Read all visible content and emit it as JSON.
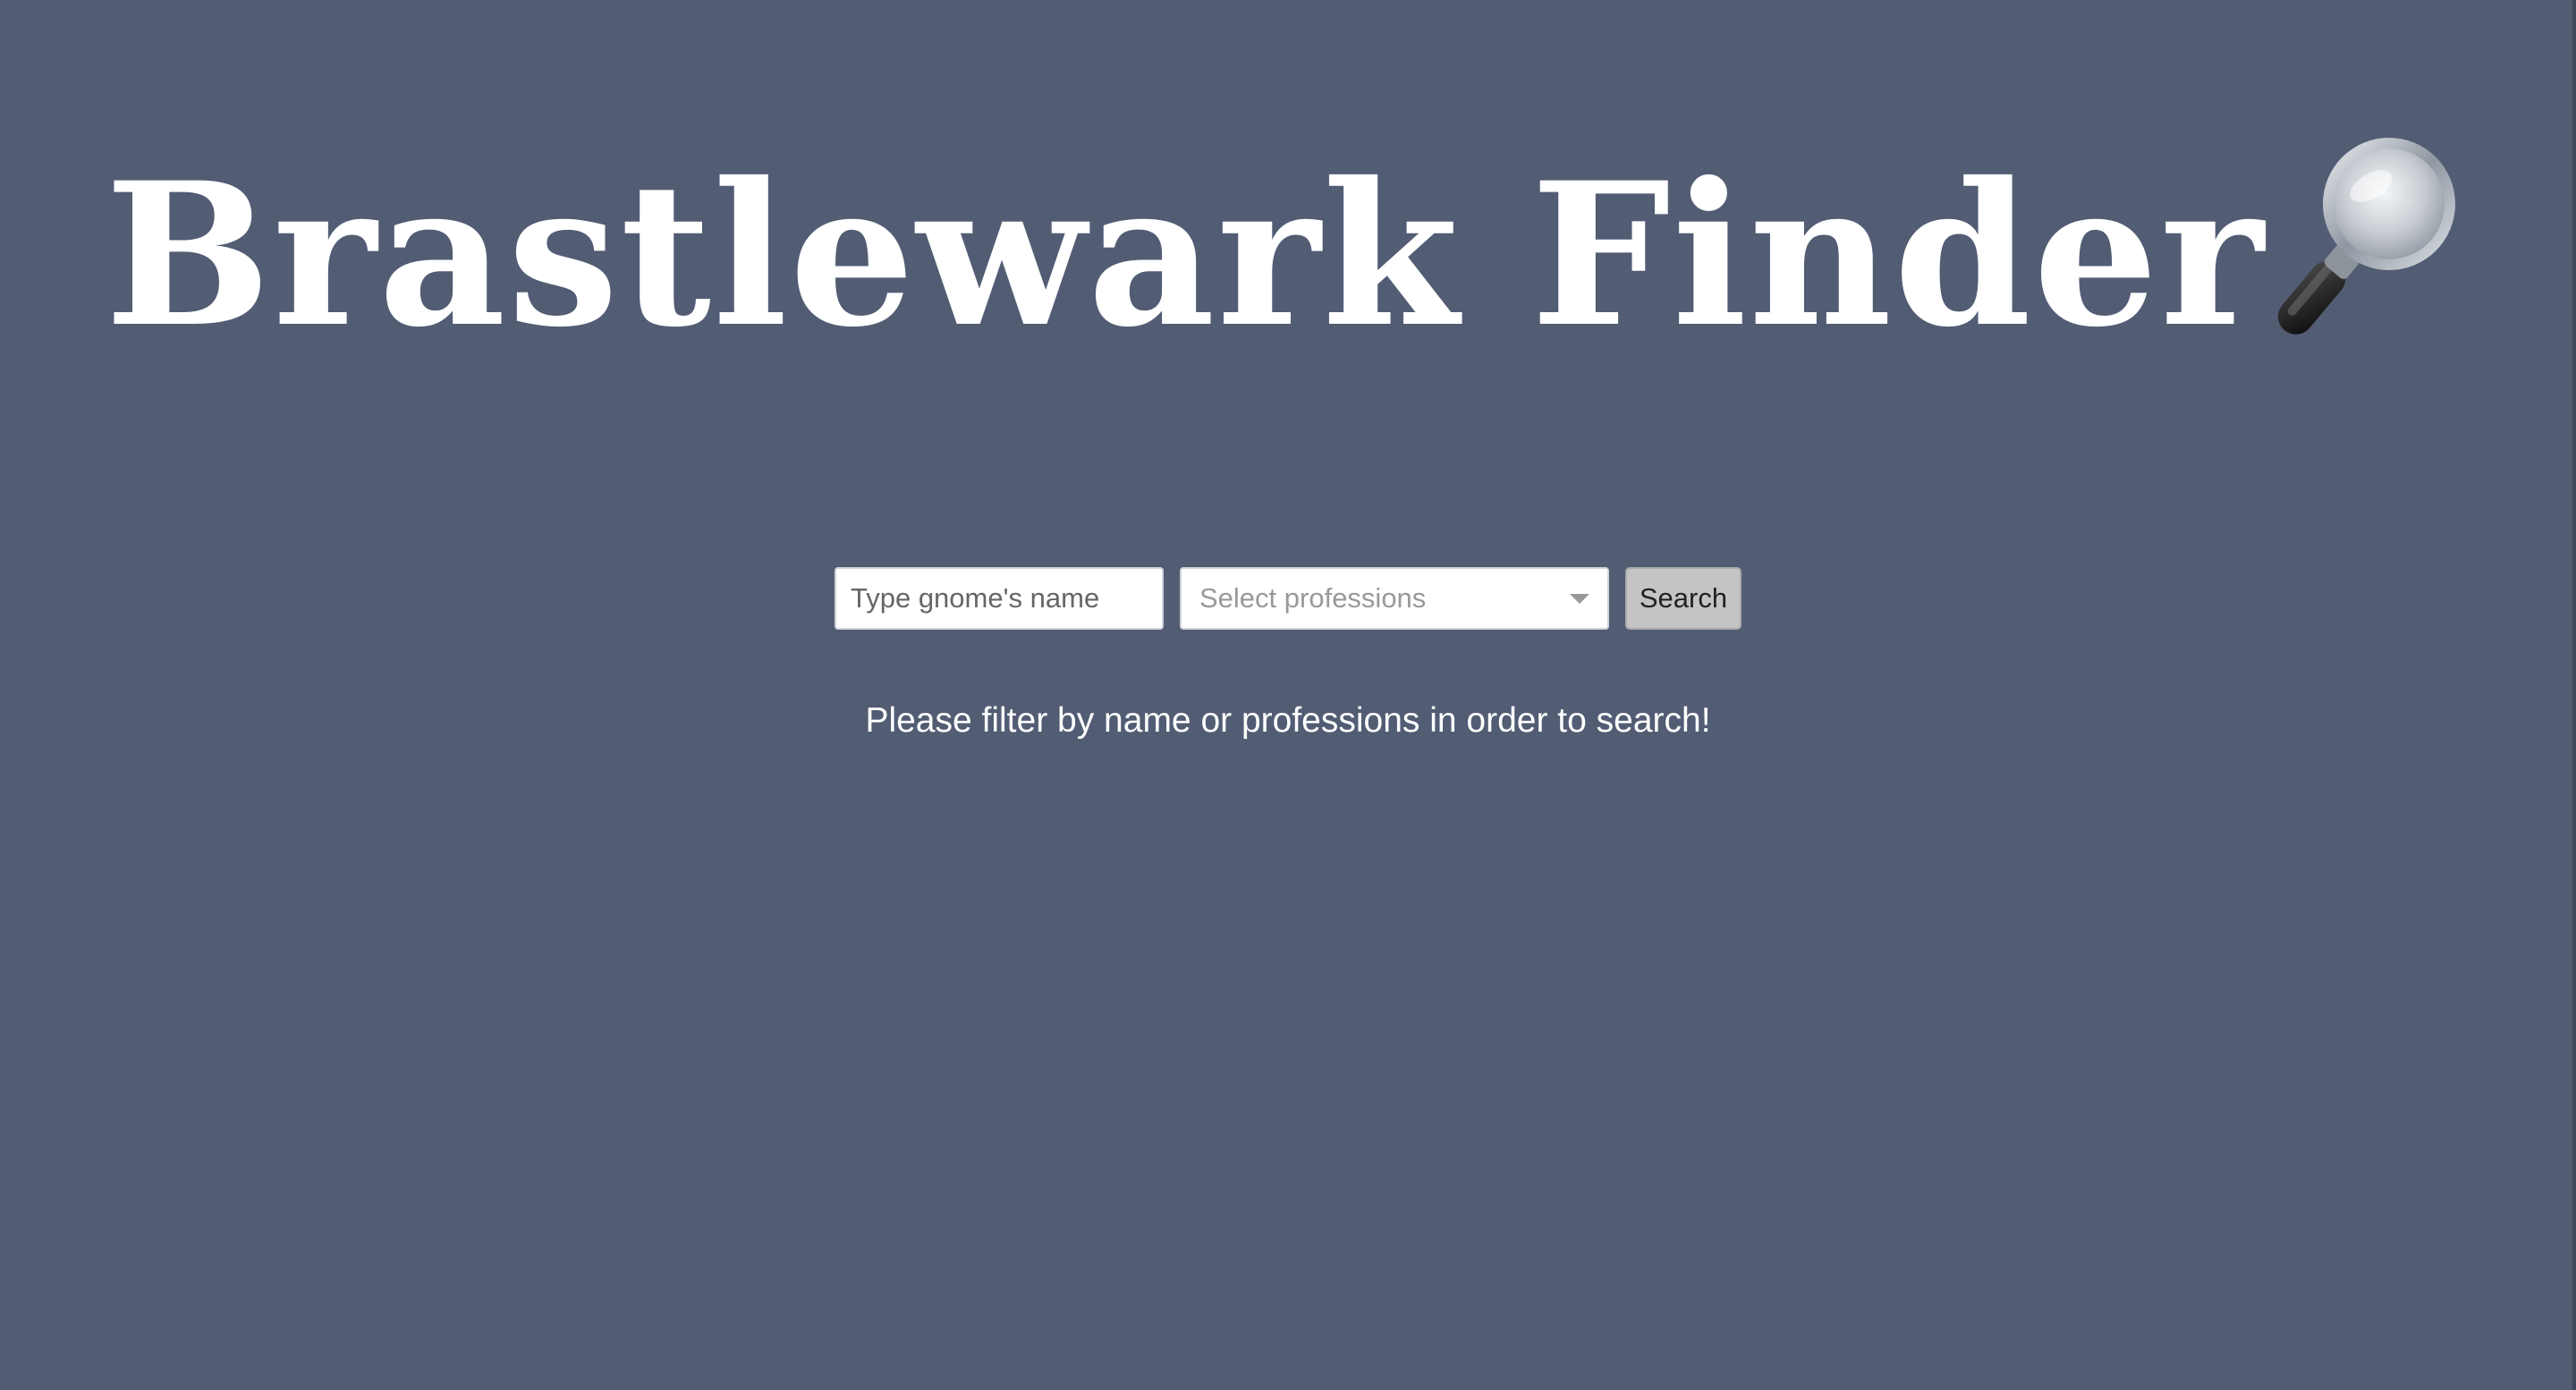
{
  "header": {
    "title": "Brastlewark Finder",
    "title_icon": "magnifying-glass-icon"
  },
  "search": {
    "name_placeholder": "Type gnome's name",
    "name_value": "",
    "professions_placeholder": "Select professions",
    "professions_icon": "chevron-down-icon",
    "button_label": "Search"
  },
  "main": {
    "hint": "Please filter by name or professions in order to search!"
  },
  "colors": {
    "background": "#525d74",
    "title": "#ffffff",
    "button": "#c4c4c4"
  }
}
